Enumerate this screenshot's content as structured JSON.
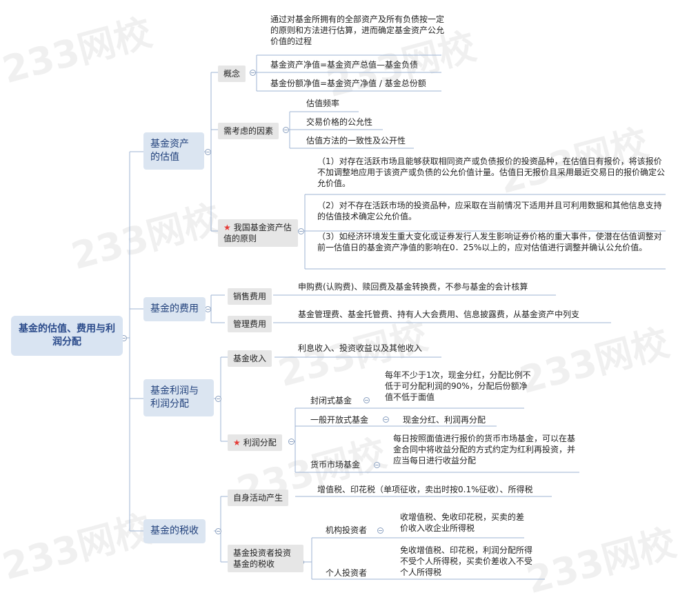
{
  "watermark": "233网校",
  "root": {
    "label": "基金的估值、费用与利润分配"
  },
  "branches": {
    "valuation": {
      "label": "基金资产的估值",
      "concept": {
        "label": "概念",
        "items": [
          "通过对基金所拥有的全部资产及所有负债按一定的原则和方法进行估算，进而确定基金资产公允价值的过程",
          "基金资产净值=基金资产总值—基金负债",
          "基金份额净值=基金资产净值 / 基金总份额"
        ]
      },
      "factors": {
        "label": "需考虑的因素",
        "items": [
          "估值频率",
          "交易价格的公允性",
          "估值方法的一致性及公开性"
        ]
      },
      "principles": {
        "label": "我国基金资产估值的原则",
        "items": [
          "（1）对存在活跃市场且能够获取相同资产或负债报价的投资品种，在估值日有报价，将该报价不加调整地应用于该资产或负债的公允价值计量。估值日无报价且采用最近交易日的报价确定公允价值。",
          "（2）对不存在活跃市场的投资品种，应采取在当前情况下适用并且可利用数据和其他信息支持的估值技术确定公允价值。",
          "（3）如经济环境发生重大变化或证券发行人发生影响证券价格的重大事件，使潜在估值调整对前一估值日的基金资产净值的影响在0．25%以上的，应对估值进行调整并确认公允价值。"
        ]
      }
    },
    "fees": {
      "label": "基金的费用",
      "sales": {
        "label": "销售费用",
        "text": "申购费(认购费)、赎回费及基金转换费，不参与基金的会计核算"
      },
      "mgmt": {
        "label": "管理费用",
        "text": "基金管理费、基金托管费、持有人大会费用、信息披露费，从基金资产中列支"
      }
    },
    "profit": {
      "label": "基金利润与利润分配",
      "income": {
        "label": "基金收入",
        "text": "利息收入、投资收益以及其他收入"
      },
      "distribution": {
        "label": "利润分配",
        "closed": {
          "label": "封闭式基金",
          "text": "每年不少于1次，现金分红，分配比例不低于可分配利润的90%，分配后份额净值不低于面值"
        },
        "open": {
          "label": "一般开放式基金",
          "text": "现金分红、利润再分配"
        },
        "money": {
          "label": "货币市场基金",
          "text": "每日按照面值进行报价的货币市场基金，可以在基金合同中将收益分配的方式约定为红利再投资，并应当每日进行收益分配"
        }
      }
    },
    "tax": {
      "label": "基金的税收",
      "self": {
        "label": "自身活动产生",
        "text": "增值税、印花税（单项征收，卖出时按0.1%征收）、所得税"
      },
      "investor": {
        "label": "基金投资者投资基金的税收",
        "inst": {
          "label": "机构投资者",
          "text": "收增值税、免收印花税，买卖的差价收入收企业所得税"
        },
        "indiv": {
          "label": "个人投资者",
          "text": "免收增值税、印花税，利润分配所得不受个人所得税，买卖价差收入不受个人所得税"
        }
      }
    }
  }
}
